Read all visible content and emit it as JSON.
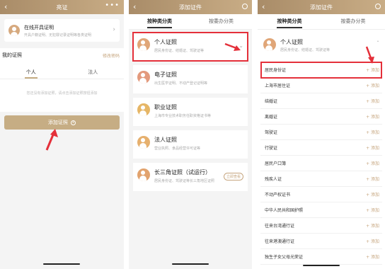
{
  "panel1": {
    "title": "亮证",
    "back_icon": "chevron-left-icon",
    "more_icon": "more-dots-icon",
    "online_cert": {
      "title": "在线开具证明",
      "subtitle": "开具户籍证明、无犯罪记录证明等各类证明"
    },
    "my_certs_label": "我的证照",
    "modify_password": "修改密码",
    "tabs": [
      "个人",
      "法人"
    ],
    "empty_hint": "您还没有添加证照，请点击添加证照按钮添加",
    "add_button": "添加证照",
    "add_button_icon": "plus-circle-icon",
    "accent_color": "#c6ad84"
  },
  "panel2": {
    "title": "添加证件",
    "tabs": [
      "按种类分类",
      "按委办分类"
    ],
    "categories": [
      {
        "title": "个人证照",
        "subtitle": "居民身份证、结婚证、驾驶证等",
        "color": "#e0a678"
      },
      {
        "title": "电子证照",
        "subtitle": "出生医学证明、不动产登记证明等",
        "color": "#e39a7d"
      },
      {
        "title": "职业证照",
        "subtitle": "上海市专业技术职务任职资格证书等",
        "color": "#e6b666"
      },
      {
        "title": "法人证照",
        "subtitle": "营业执照、食品经营许可证等",
        "color": "#e6b06e"
      },
      {
        "title": "长三角证照（试运行）",
        "subtitle": "居民身份证、驾驶证等长三角地区证照",
        "color": "#e2a36e",
        "badge": "立即查看"
      }
    ]
  },
  "panel3": {
    "title": "添加证件",
    "tabs": [
      "按种类分类",
      "按委办分类"
    ],
    "header": {
      "title": "个人证照",
      "subtitle": "居民身份证、结婚证、驾驶证等"
    },
    "add_label": "+ 添加",
    "items": [
      "居民身份证",
      "上海市居住证",
      "结婚证",
      "离婚证",
      "驾驶证",
      "行驶证",
      "居民户口簿",
      "残疾人证",
      "不动产权证书",
      "中华人民共和国护照",
      "往来台湾通行证",
      "往来港澳通行证",
      "独生子女父母光荣证"
    ],
    "highlight_color": "#e4303a"
  }
}
